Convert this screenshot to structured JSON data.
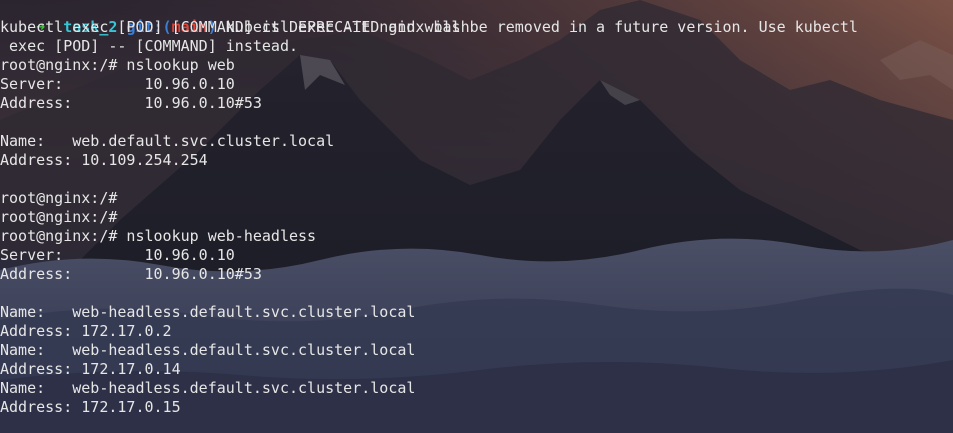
{
  "prompt": {
    "arrow": "➜",
    "dir": "task_2",
    "git_label": "git:(",
    "branch": "main",
    "git_close": ")",
    "command": "kubectl exec -it nginx bash"
  },
  "lines": [
    "kubectl exec [POD] [COMMAND] is DEPRECATED and will be removed in a future version. Use kubectl",
    " exec [POD] -- [COMMAND] instead.",
    "root@nginx:/# nslookup web",
    "Server:         10.96.0.10",
    "Address:        10.96.0.10#53",
    "",
    "Name:   web.default.svc.cluster.local",
    "Address: 10.109.254.254",
    "",
    "root@nginx:/#",
    "root@nginx:/#",
    "root@nginx:/# nslookup web-headless",
    "Server:         10.96.0.10",
    "Address:        10.96.0.10#53",
    "",
    "Name:   web-headless.default.svc.cluster.local",
    "Address: 172.17.0.2",
    "Name:   web-headless.default.svc.cluster.local",
    "Address: 172.17.0.14",
    "Name:   web-headless.default.svc.cluster.local",
    "Address: 172.17.0.15"
  ],
  "colors": {
    "arrow": "#3ec23e",
    "dir": "#38c5d4",
    "git": "#3b7fd6",
    "branch": "#e0453a",
    "text": "#e6e6e6"
  }
}
